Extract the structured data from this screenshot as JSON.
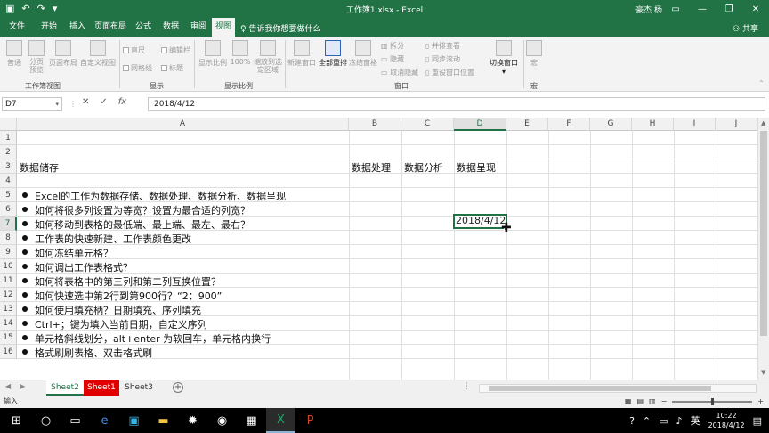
{
  "window": {
    "title": "工作簿1.xlsx - Excel",
    "user": "豪杰 杨",
    "minimize_icon": "minimize-icon",
    "maximize_icon": "restore-icon",
    "close_icon": "close-icon"
  },
  "quick_access": {
    "save": "save-icon",
    "undo": "undo-icon",
    "redo": "redo-icon",
    "customize": "dropdown-icon"
  },
  "tabs": [
    {
      "label": "文件"
    },
    {
      "label": "开始"
    },
    {
      "label": "插入"
    },
    {
      "label": "页面布局"
    },
    {
      "label": "公式"
    },
    {
      "label": "数据"
    },
    {
      "label": "审阅"
    },
    {
      "label": "视图",
      "active": true
    }
  ],
  "tell_me": "告诉我你想要做什么",
  "share": "共享",
  "ribbon": {
    "workbook_views": {
      "name": "工作簿视图",
      "normal": "普通",
      "page_break": "分页预览",
      "page_layout": "页面布局",
      "custom": "自定义视图"
    },
    "show": {
      "name": "显示",
      "ruler": "直尺",
      "formula_bar": "编辑栏",
      "gridlines": "网格线",
      "headings": "标题"
    },
    "zoom": {
      "name": "显示比例",
      "zoom": "显示比例",
      "hundred": "100%",
      "to_selection": "缩放到选定区域"
    },
    "window": {
      "name": "窗口",
      "new_window": "新建窗口",
      "arrange_all": "全部重排",
      "freeze": "冻结窗格",
      "split": "拆分",
      "hide": "隐藏",
      "unhide": "取消隐藏",
      "side_by_side": "并排查看",
      "sync_scroll": "同步滚动",
      "reset_pos": "重设窗口位置",
      "switch": "切换窗口"
    },
    "macros": {
      "name": "宏",
      "macro": "宏"
    }
  },
  "formula_bar": {
    "name_box": "D7",
    "cancel": "✕",
    "enter": "✓",
    "fx": "fx",
    "value": "2018/4/12"
  },
  "columns": [
    "A",
    "B",
    "C",
    "D",
    "E",
    "F",
    "G",
    "H",
    "I",
    "J"
  ],
  "rows": [
    "1",
    "2",
    "3",
    "4",
    "5",
    "6",
    "7",
    "8",
    "9",
    "10",
    "11",
    "12",
    "13",
    "14",
    "15",
    "16"
  ],
  "cells": {
    "A3": "数据储存",
    "B3": "数据处理",
    "C3": "数据分析",
    "D3": "数据呈现",
    "D7": "2018/4/12"
  },
  "bullets": [
    {
      "row": "5",
      "text": "Excel的工作为数据存储、数据处理、数据分析、数据呈现"
    },
    {
      "row": "6",
      "text": "如何将很多列设置为等宽？设置为最合适的列宽？"
    },
    {
      "row": "7",
      "text": "如何移动到表格的最低端、最上端、最左、最右？"
    },
    {
      "row": "8",
      "text": "工作表的快速新建、工作表颜色更改"
    },
    {
      "row": "9",
      "text": "如何冻结单元格？"
    },
    {
      "row": "10",
      "text": "如何调出工作表格式？"
    },
    {
      "row": "11",
      "text": "如何将表格中的第三列和第二列互换位置？"
    },
    {
      "row": "12",
      "text": "如何快速选中第2行到第900行？“2：900”"
    },
    {
      "row": "13",
      "text": "如何使用填充柄？日期填充、序列填充"
    },
    {
      "row": "14",
      "text": "Ctrl+；键为填入当前日期，自定义序列"
    },
    {
      "row": "15",
      "text": "单元格斜线划分，alt+enter 为软回车，单元格内换行"
    },
    {
      "row": "16",
      "text": "格式刷刷表格、双击格式刷"
    }
  ],
  "sheets": [
    {
      "label": "Sheet2",
      "color": "#217346"
    },
    {
      "label": "Sheet1",
      "color": "#e00000"
    },
    {
      "label": "Sheet3",
      "color": ""
    }
  ],
  "status": {
    "mode": "输入"
  },
  "taskbar": {
    "clock_time": "10:22",
    "clock_date": "2018/4/12",
    "ime": "英"
  }
}
